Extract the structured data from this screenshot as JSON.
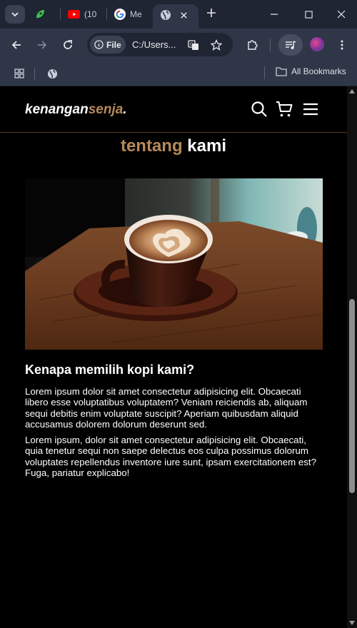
{
  "browser": {
    "tabs": [
      {
        "label": ""
      },
      {
        "label": "(10"
      },
      {
        "label": "Me"
      },
      {
        "label": ""
      }
    ],
    "url_chip": "File",
    "url": "C:/Users...",
    "bookmarks_label": "All Bookmarks"
  },
  "site": {
    "logo_main": "kenangan",
    "logo_accent": "senja",
    "logo_dot": "."
  },
  "about": {
    "title_accent": "tentang",
    "title_main": " kami",
    "heading": "Kenapa memilih kopi kami?",
    "paragraph_1": "Lorem ipsum dolor sit amet consectetur adipisicing elit. Obcaecati libero esse voluptatibus voluptatem? Veniam reiciendis ab, aliquam sequi debitis enim voluptate suscipit? Aperiam quibusdam aliquid accusamus dolorem dolorum deserunt sed.",
    "paragraph_2": "Lorem ipsum, dolor sit amet consectetur adipisicing elit. Obcaecati, quia tenetur sequi non saepe delectus eos culpa possimus dolorum voluptates repellendus inventore iure sunt, ipsam exercitationem est? Fuga, pariatur explicabo!"
  },
  "colors": {
    "accent": "#b6895b",
    "page_bg": "#000000",
    "chrome_bg": "#2e3647"
  }
}
